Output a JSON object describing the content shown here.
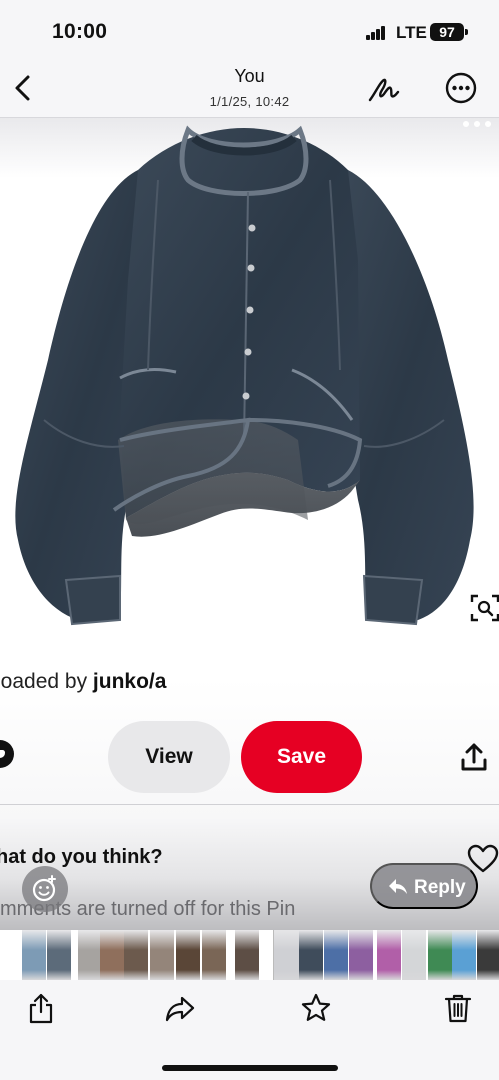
{
  "status_bar": {
    "time": "10:00",
    "network": "LTE",
    "battery": "97"
  },
  "header": {
    "title": "You",
    "subtitle": "1/1/25, 10:42"
  },
  "pin": {
    "uploaded_prefix": "loaded by ",
    "uploader": "junko/a",
    "view_label": "View",
    "save_label": "Save",
    "comment_prompt": "hat do you think?",
    "comments_notice": "mments are turned off for this Pin",
    "reply_label": "Reply"
  },
  "colors": {
    "save": "#e60023",
    "denim": "#2f3d4c"
  },
  "thumbnails": [
    {
      "c": "#7d9bb5"
    },
    {
      "c": "#5c6b7a"
    },
    {
      "c": "#a6a3a0"
    },
    {
      "c": "#8f6f5c"
    },
    {
      "c": "#6c5a4d"
    },
    {
      "c": "#94857a"
    },
    {
      "c": "#5a4637"
    },
    {
      "c": "#7a6656"
    },
    {
      "c": "#5d4e45"
    },
    {
      "c": "#cfd0d4"
    },
    {
      "c": "#3f4c5b"
    },
    {
      "c": "#4d6fa6"
    },
    {
      "c": "#8d5fa0"
    },
    {
      "c": "#b15fa8"
    },
    {
      "c": "#d4d6d8"
    },
    {
      "c": "#3f8a54"
    },
    {
      "c": "#5aa0d4"
    },
    {
      "c": "#3a3a3a"
    },
    {
      "c": "#4c4c54"
    },
    {
      "c": "#c8b8a8"
    },
    {
      "c": "#9e8a7a"
    }
  ],
  "toolbar": [
    "share-icon",
    "forward-icon",
    "favorite-star-icon",
    "trash-icon"
  ]
}
